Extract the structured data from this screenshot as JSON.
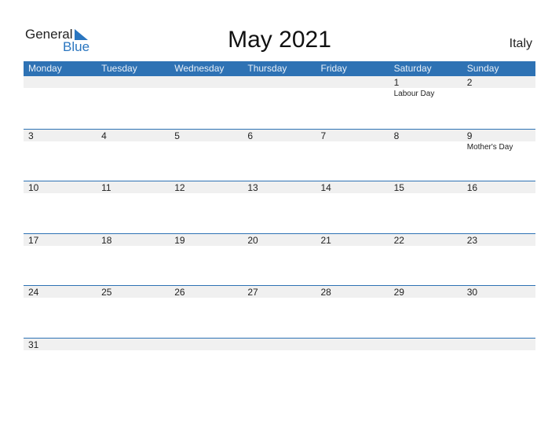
{
  "logo": {
    "general": "General",
    "blue": "Blue"
  },
  "title": "May 2021",
  "country": "Italy",
  "weekdays": [
    "Monday",
    "Tuesday",
    "Wednesday",
    "Thursday",
    "Friday",
    "Saturday",
    "Sunday"
  ],
  "weeks": [
    [
      {
        "d": "",
        "h": ""
      },
      {
        "d": "",
        "h": ""
      },
      {
        "d": "",
        "h": ""
      },
      {
        "d": "",
        "h": ""
      },
      {
        "d": "",
        "h": ""
      },
      {
        "d": "1",
        "h": "Labour Day"
      },
      {
        "d": "2",
        "h": ""
      }
    ],
    [
      {
        "d": "3",
        "h": ""
      },
      {
        "d": "4",
        "h": ""
      },
      {
        "d": "5",
        "h": ""
      },
      {
        "d": "6",
        "h": ""
      },
      {
        "d": "7",
        "h": ""
      },
      {
        "d": "8",
        "h": ""
      },
      {
        "d": "9",
        "h": "Mother's Day"
      }
    ],
    [
      {
        "d": "10",
        "h": ""
      },
      {
        "d": "11",
        "h": ""
      },
      {
        "d": "12",
        "h": ""
      },
      {
        "d": "13",
        "h": ""
      },
      {
        "d": "14",
        "h": ""
      },
      {
        "d": "15",
        "h": ""
      },
      {
        "d": "16",
        "h": ""
      }
    ],
    [
      {
        "d": "17",
        "h": ""
      },
      {
        "d": "18",
        "h": ""
      },
      {
        "d": "19",
        "h": ""
      },
      {
        "d": "20",
        "h": ""
      },
      {
        "d": "21",
        "h": ""
      },
      {
        "d": "22",
        "h": ""
      },
      {
        "d": "23",
        "h": ""
      }
    ],
    [
      {
        "d": "24",
        "h": ""
      },
      {
        "d": "25",
        "h": ""
      },
      {
        "d": "26",
        "h": ""
      },
      {
        "d": "27",
        "h": ""
      },
      {
        "d": "28",
        "h": ""
      },
      {
        "d": "29",
        "h": ""
      },
      {
        "d": "30",
        "h": ""
      }
    ],
    [
      {
        "d": "31",
        "h": ""
      },
      {
        "d": "",
        "h": ""
      },
      {
        "d": "",
        "h": ""
      },
      {
        "d": "",
        "h": ""
      },
      {
        "d": "",
        "h": ""
      },
      {
        "d": "",
        "h": ""
      },
      {
        "d": "",
        "h": ""
      }
    ]
  ]
}
